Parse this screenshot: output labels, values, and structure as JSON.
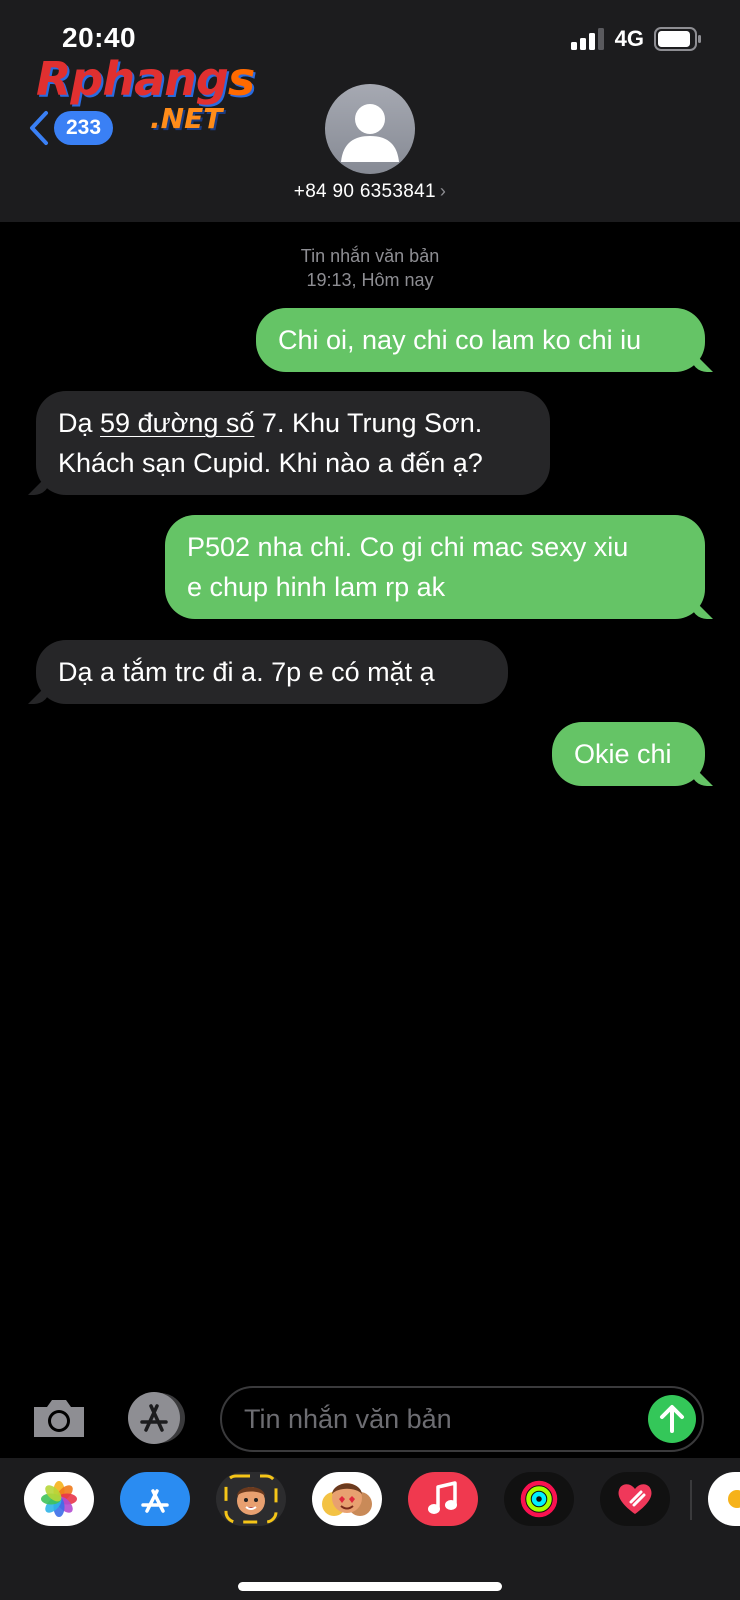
{
  "status_bar": {
    "time": "20:40",
    "network": "4G"
  },
  "watermark": {
    "brand_main": "Rphang",
    "brand_s": "s",
    "brand_net": ".NET"
  },
  "header": {
    "back_badge": "233",
    "contact_number": "+84 90 6353841",
    "chevron": "›"
  },
  "conversation": {
    "meta_type": "Tin nhắn văn bản",
    "meta_time": "19:13, Hôm nay",
    "messages": [
      {
        "direction": "sent",
        "text": "Chi oi, nay chi co lam ko chi iu"
      },
      {
        "direction": "received",
        "line1_pre": "Dạ ",
        "line1_link": "59 đường số",
        "line1_post": " 7. Khu Trung Sơn.",
        "line2": "Khách sạn Cupid. Khi nào a đến ạ?"
      },
      {
        "direction": "sent",
        "line1": "P502 nha chi. Co gi chi mac sexy xiu",
        "line2": "e chup hinh lam rp ak"
      },
      {
        "direction": "received",
        "text": "Dạ a tắm trc đi a. 7p e có mặt ạ"
      },
      {
        "direction": "sent",
        "text": "Okie chi"
      }
    ]
  },
  "compose": {
    "placeholder": "Tin nhắn văn bản"
  },
  "icons": [
    "camera-icon",
    "app-store-icon",
    "send-arrow-icon",
    "photos-icon",
    "memoji-icon",
    "music-icon",
    "activity-icon",
    "heart-icon"
  ],
  "colors": {
    "sent_bubble": "#65c466",
    "received_bubble": "#262628",
    "badge": "#3a80f5",
    "send_button": "#34c759"
  }
}
